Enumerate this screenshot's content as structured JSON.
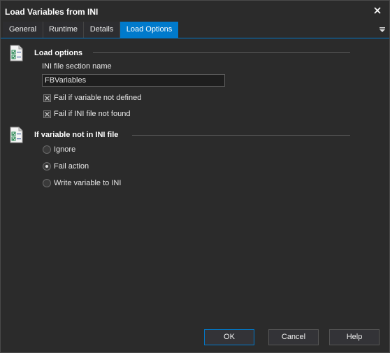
{
  "window": {
    "title": "Load Variables from INI"
  },
  "tabs": [
    {
      "label": "General"
    },
    {
      "label": "Runtime"
    },
    {
      "label": "Details"
    },
    {
      "label": "Load Options",
      "active": true
    }
  ],
  "load_options": {
    "title": "Load options",
    "ini_section_label": "INI file section name",
    "ini_section_value": "FBVariables",
    "fail_if_variable_not_defined": {
      "label": "Fail if variable not defined",
      "checked": true
    },
    "fail_if_ini_not_found": {
      "label": "Fail if INI file not found",
      "checked": true
    }
  },
  "not_in_ini": {
    "title": "If variable not in INI file",
    "options": [
      {
        "label": "Ignore",
        "selected": false
      },
      {
        "label": "Fail action",
        "selected": true
      },
      {
        "label": "Write variable to INI",
        "selected": false
      }
    ]
  },
  "buttons": {
    "ok": "OK",
    "cancel": "Cancel",
    "help": "Help"
  },
  "colors": {
    "accent": "#007acc",
    "background": "#2b2b2b"
  }
}
